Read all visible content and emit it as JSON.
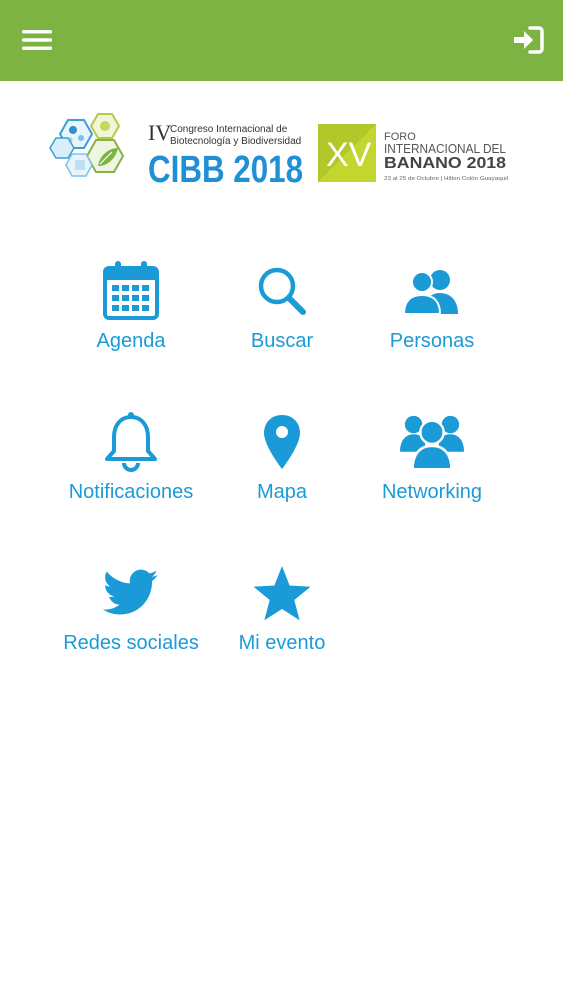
{
  "colors": {
    "appbar": "#7cb342",
    "accent": "#1a9bd7"
  },
  "appbar": {
    "menu_icon": "hamburger-menu-icon",
    "login_icon": "sign-in-icon"
  },
  "banner": {
    "cibb": {
      "roman": "IV",
      "line1": "Congreso Internacional de",
      "line2": "Biotecnología y Biodiversidad",
      "title": "CIBB 2018"
    },
    "foro": {
      "roman": "XV",
      "line1": "FORO",
      "line2": "INTERNACIONAL DEL",
      "line3": "BANANO 2018",
      "line4": "23 al 25 de Octubre | Hilton Colón Guayaquil"
    }
  },
  "menu": {
    "items": [
      {
        "label": "Agenda",
        "icon": "calendar-icon"
      },
      {
        "label": "Buscar",
        "icon": "search-icon"
      },
      {
        "label": "Personas",
        "icon": "people-icon"
      },
      {
        "label": "Notificaciones",
        "icon": "bell-icon"
      },
      {
        "label": "Mapa",
        "icon": "map-pin-icon"
      },
      {
        "label": "Networking",
        "icon": "group-icon"
      },
      {
        "label": "Redes sociales",
        "icon": "twitter-icon"
      },
      {
        "label": "Mi evento",
        "icon": "star-icon"
      }
    ]
  }
}
